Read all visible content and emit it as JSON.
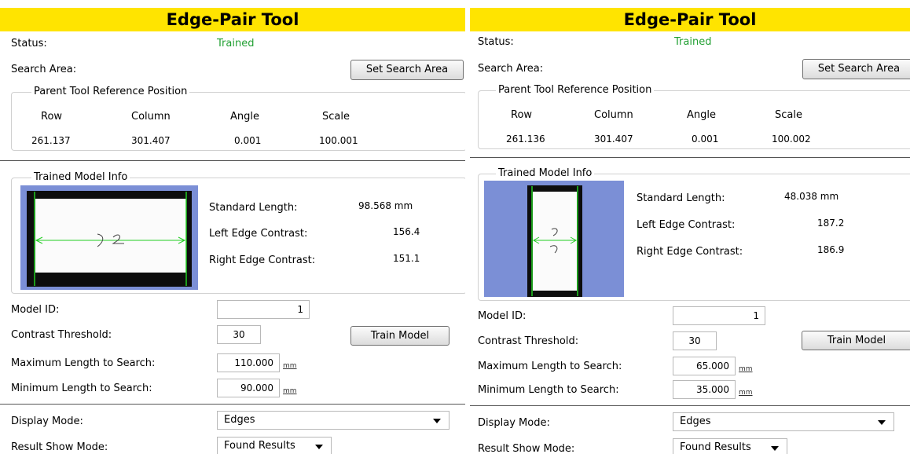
{
  "panels": [
    {
      "title": "Edge-Pair Tool",
      "status_label": "Status:",
      "status_value": "Trained",
      "search_area_label": "Search Area:",
      "set_search_area_button": "Set Search Area",
      "parent_ref": {
        "legend": "Parent Tool Reference Position",
        "headers": [
          "Row",
          "Column",
          "Angle",
          "Scale"
        ],
        "values": [
          "261.137",
          "301.407",
          "0.001",
          "100.001"
        ]
      },
      "trained_model": {
        "legend": "Trained Model Info",
        "standard_length_label": "Standard Length:",
        "standard_length_value": "98.568 mm",
        "left_edge_contrast_label": "Left Edge Contrast:",
        "left_edge_contrast_value": "156.4",
        "right_edge_contrast_label": "Right Edge Contrast:",
        "right_edge_contrast_value": "151.1"
      },
      "model_id_label": "Model ID:",
      "model_id_value": "1",
      "contrast_threshold_label": "Contrast Threshold:",
      "contrast_threshold_value": "30",
      "train_model_button": "Train Model",
      "max_length_label": "Maximum Length to Search:",
      "max_length_value": "110.000",
      "min_length_label": "Minimum Length to Search:",
      "min_length_value": "90.000",
      "unit": "mm",
      "display_mode_label": "Display Mode:",
      "display_mode_value": "Edges",
      "result_show_mode_label": "Result Show Mode:",
      "result_show_mode_value": "Found Results"
    },
    {
      "title": "Edge-Pair Tool",
      "status_label": "Status:",
      "status_value": "Trained",
      "search_area_label": "Search Area:",
      "set_search_area_button": "Set Search Area",
      "parent_ref": {
        "legend": "Parent Tool Reference Position",
        "headers": [
          "Row",
          "Column",
          "Angle",
          "Scale"
        ],
        "values": [
          "261.136",
          "301.407",
          "0.001",
          "100.002"
        ]
      },
      "trained_model": {
        "legend": "Trained Model Info",
        "standard_length_label": "Standard Length:",
        "standard_length_value": "48.038 mm",
        "left_edge_contrast_label": "Left Edge Contrast:",
        "left_edge_contrast_value": "187.2",
        "right_edge_contrast_label": "Right Edge Contrast:",
        "right_edge_contrast_value": "186.9"
      },
      "model_id_label": "Model ID:",
      "model_id_value": "1",
      "contrast_threshold_label": "Contrast Threshold:",
      "contrast_threshold_value": "30",
      "train_model_button": "Train Model",
      "max_length_label": "Maximum Length to Search:",
      "max_length_value": "65.000",
      "min_length_label": "Minimum Length to Search:",
      "min_length_value": "35.000",
      "unit": "mm",
      "display_mode_label": "Display Mode:",
      "display_mode_value": "Edges",
      "result_show_mode_label": "Result Show Mode:",
      "result_show_mode_value": "Found Results"
    }
  ],
  "colors": {
    "title_bar": "#FFE400",
    "status_ok": "#22A033",
    "thumbnail_bg": "#7B8FD6",
    "edge_line": "#22CC22"
  },
  "icons": {
    "dropdown": "chevron-down-icon"
  }
}
